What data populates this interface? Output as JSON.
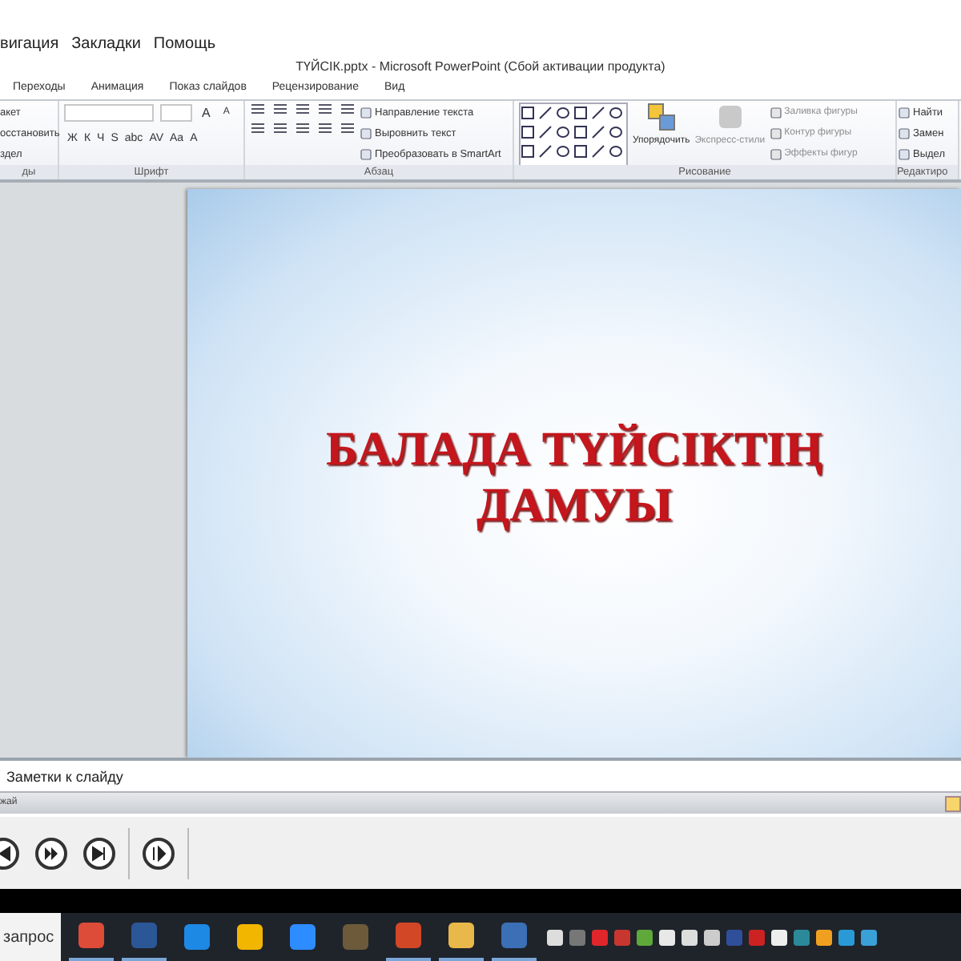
{
  "menu_bar": {
    "items": [
      "вигация",
      "Закладки",
      "Помощь"
    ]
  },
  "window": {
    "title": "ТҮЙСІК.pptx  -  Microsoft PowerPoint (Сбой активации продукта)"
  },
  "ribbon": {
    "tabs": [
      {
        "label": "Переходы",
        "selected": false
      },
      {
        "label": "Анимация",
        "selected": false
      },
      {
        "label": "Показ слайдов",
        "selected": false
      },
      {
        "label": "Рецензирование",
        "selected": false
      },
      {
        "label": "Вид",
        "selected": false
      }
    ],
    "groups": [
      {
        "kind": "slides",
        "label": "ды",
        "commands": [
          {
            "label": "акет",
            "disabled": false
          },
          {
            "label": "осстановить",
            "disabled": false
          },
          {
            "label": "здел",
            "disabled": false
          }
        ]
      },
      {
        "kind": "font",
        "label": "Шрифт",
        "grow_buttons": [
          "A",
          "A"
        ],
        "format_buttons": [
          "Ж",
          "К",
          "Ч",
          "S",
          "abc",
          "AV",
          "Aa",
          "A"
        ]
      },
      {
        "kind": "paragraph",
        "label": "Абзац",
        "commands": [
          {
            "label": "Направление текста",
            "disabled": false
          },
          {
            "label": "Выровнить текст",
            "disabled": false
          },
          {
            "label": "Преобразовать в SmartArt",
            "disabled": false
          }
        ]
      },
      {
        "kind": "drawing",
        "label": "Рисование",
        "big_commands": [
          {
            "label": "Упорядочить",
            "disabled": false
          },
          {
            "label": "Экспресс-стили",
            "disabled": true
          }
        ],
        "commands": [
          {
            "label": "Заливка фигуры",
            "disabled": true
          },
          {
            "label": "Контур фигуры",
            "disabled": true
          },
          {
            "label": "Эффекты фигур",
            "disabled": true
          }
        ]
      },
      {
        "kind": "editing",
        "label": "Редактиро",
        "commands": [
          {
            "label": "Найти",
            "disabled": false
          },
          {
            "label": "Замен",
            "disabled": false
          },
          {
            "label": "Выдел",
            "disabled": false
          }
        ]
      }
    ]
  },
  "slide": {
    "title_lines": [
      "БАЛАДА ТҮЙСІКТІҢ",
      "ДАМУЫ"
    ]
  },
  "notes": {
    "placeholder": "Заметки к слайду"
  },
  "status_bar": {
    "text": "жай"
  },
  "player": {
    "buttons": [
      {
        "kind": "previous"
      },
      {
        "kind": "fast_forward"
      },
      {
        "kind": "next"
      },
      {
        "kind": "pause"
      }
    ]
  },
  "taskbar": {
    "search": {
      "placeholder": "запрос"
    },
    "apps": [
      {
        "color": "#dd4b39",
        "running": true
      },
      {
        "color": "#2b5797",
        "running": true
      },
      {
        "color": "#1e88e5",
        "running": false
      },
      {
        "color": "#f2b600",
        "running": false
      },
      {
        "color": "#2d8cff",
        "running": false
      },
      {
        "color": "#6d5a3a",
        "running": false
      },
      {
        "color": "#d24726",
        "running": true
      },
      {
        "color": "#e8b84a",
        "running": true
      },
      {
        "color": "#3b6fb6",
        "running": true
      }
    ]
  }
}
